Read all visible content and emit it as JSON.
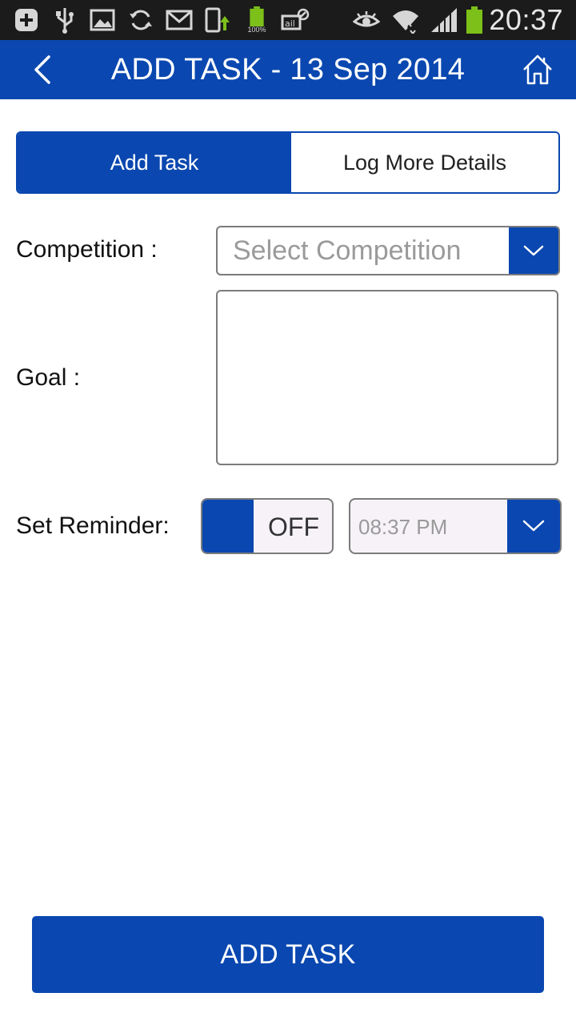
{
  "status_bar": {
    "time": "20:37",
    "battery_small_label": "100%",
    "icons": [
      "add-icon",
      "usb-icon",
      "image-icon",
      "sync-icon",
      "gmail-icon",
      "phone-upload-icon",
      "battery-icon",
      "nfc-icon",
      "eye-icon",
      "wifi-icon",
      "signal-icon",
      "battery-icon"
    ]
  },
  "app_bar": {
    "title": "ADD TASK - 13 Sep 2014",
    "back_icon": "chevron-left-icon",
    "home_icon": "home-icon"
  },
  "tabs": {
    "add_task": "Add Task",
    "log_more_details": "Log More Details",
    "active": "Add Task"
  },
  "form": {
    "competition_label": "Competition :",
    "competition_placeholder": "Select Competition",
    "goal_label": "Goal :",
    "goal_value": "",
    "reminder_label": "Set Reminder:",
    "reminder_state": "OFF",
    "reminder_time": "08:37 PM"
  },
  "actions": {
    "add_task_button": "ADD TASK"
  },
  "colors": {
    "primary": "#0a47b0",
    "status_bar_bg": "#1b1b1b",
    "battery_green": "#7cc019"
  }
}
